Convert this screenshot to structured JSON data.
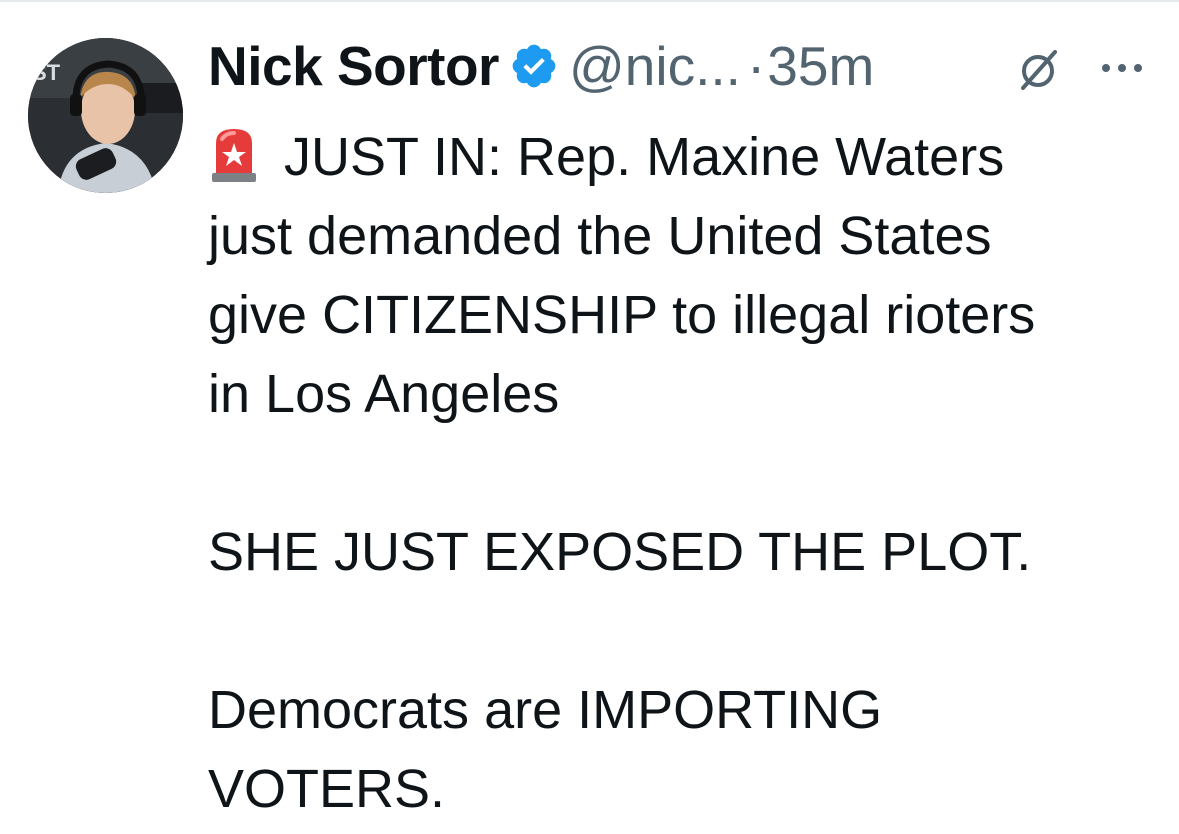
{
  "tweet": {
    "author": {
      "display_name": "Nick Sortor",
      "handle": "@nic...",
      "verified": true,
      "avatar_icon": "avatar-photo",
      "avatar_text": "ST"
    },
    "separator": "·",
    "timestamp": "35m",
    "grok_icon": "grok-icon",
    "more_icon": "more-dots-icon",
    "lines": [
      {
        "emoji": "siren",
        "text": "JUST IN: Rep. Maxine Waters"
      },
      {
        "text": "just demanded the United States"
      },
      {
        "text": "give CITIZENSHIP to illegal rioters"
      },
      {
        "text": "in Los Angeles"
      },
      {
        "text": ""
      },
      {
        "text": "SHE JUST EXPOSED THE PLOT."
      },
      {
        "text": ""
      },
      {
        "text": "Democrats are IMPORTING"
      },
      {
        "text": "VOTERS."
      }
    ]
  },
  "colors": {
    "text": "#0f1419",
    "muted": "#536471",
    "verified_blue": "#1d9bf0",
    "divider": "#e6e9ec"
  }
}
